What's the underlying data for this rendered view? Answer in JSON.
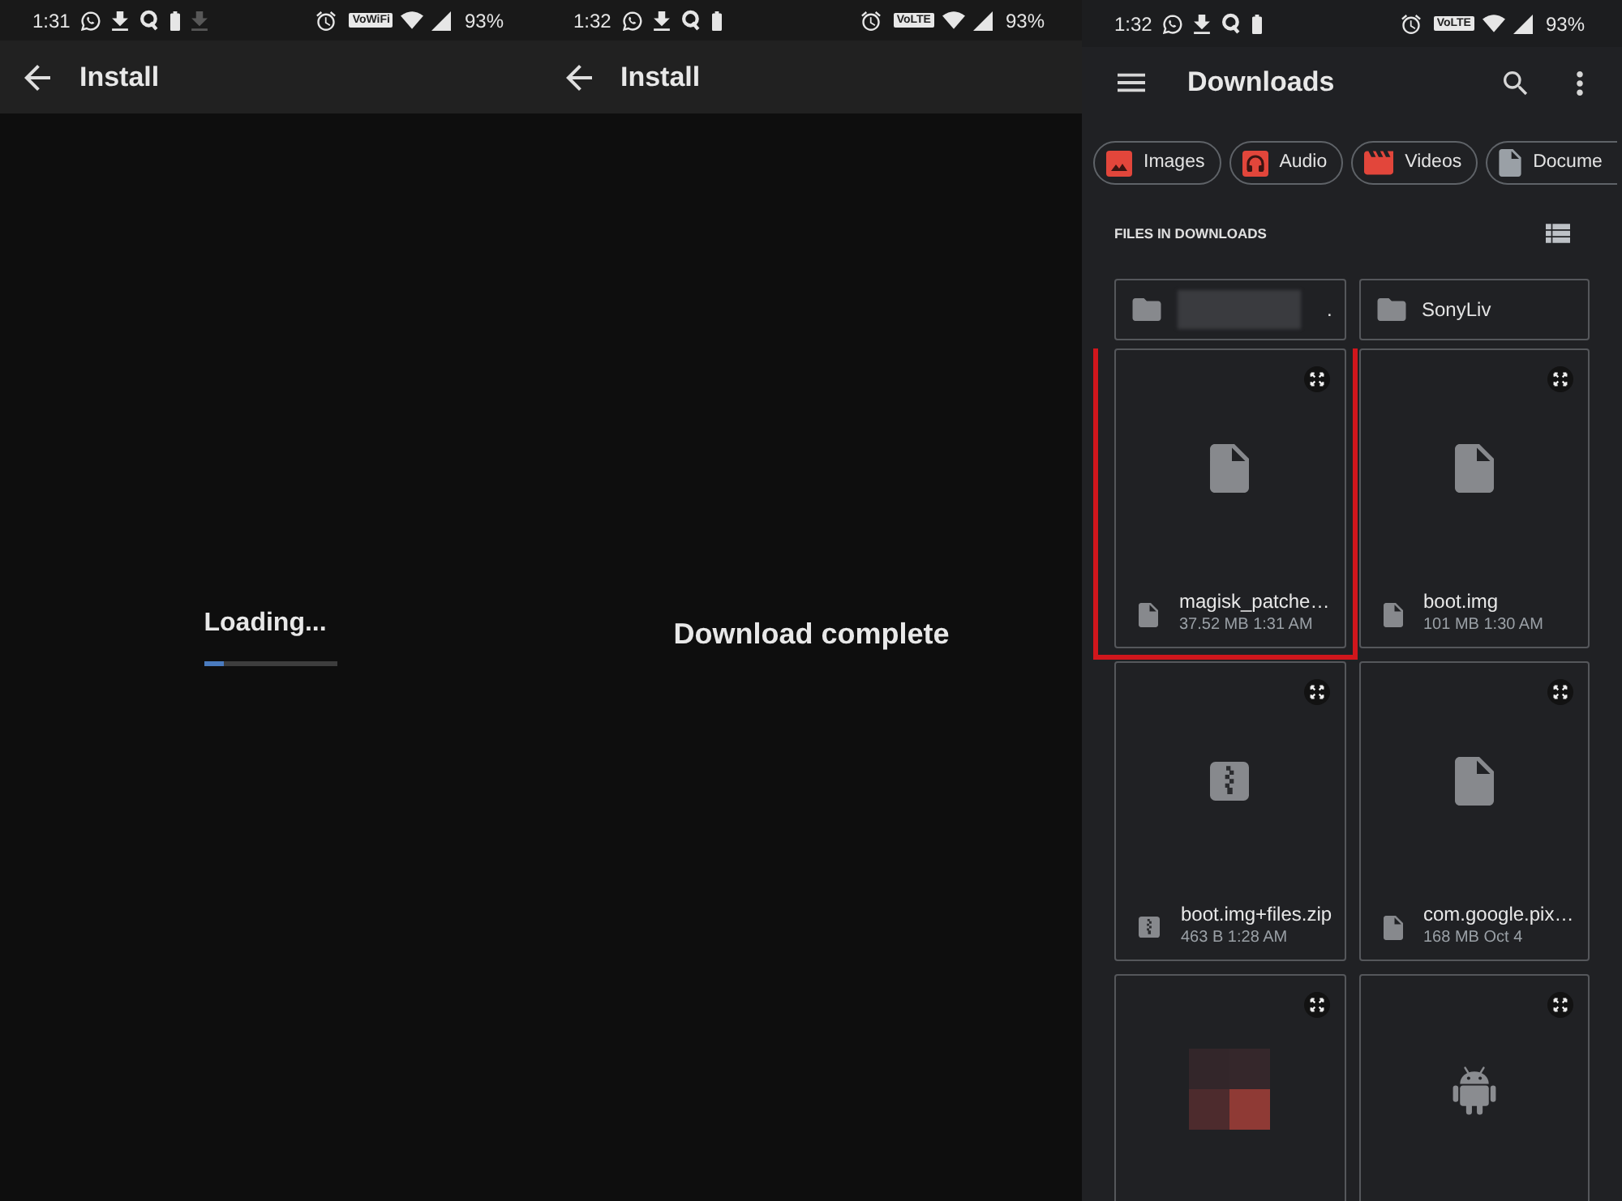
{
  "screens": [
    {
      "kind": "loading",
      "status_bar": {
        "time": "1:31",
        "notifications": [
          {
            "kind": "chat",
            "dimmed": false
          },
          {
            "kind": "download",
            "dimmed": false
          },
          {
            "kind": "q",
            "dimmed": false
          },
          {
            "kind": "battery",
            "dimmed": false
          },
          {
            "kind": "download",
            "dimmed": true
          }
        ],
        "network_badge": "VoWiFi",
        "battery": "93%"
      },
      "title": "Install",
      "message": "Loading...",
      "progress": {
        "level": 0.15
      }
    },
    {
      "kind": "message",
      "status_bar": {
        "time": "1:32",
        "notifications": [
          {
            "kind": "chat",
            "dimmed": false
          },
          {
            "kind": "download",
            "dimmed": false
          },
          {
            "kind": "q",
            "dimmed": false
          },
          {
            "kind": "battery",
            "dimmed": false
          }
        ],
        "network_badge": "VoLTE",
        "battery": "93%"
      },
      "title": "Install",
      "message": "Download complete"
    }
  ],
  "files_app": {
    "status_bar": {
      "time": "1:32",
      "notifications": [
        {
          "kind": "chat",
          "dimmed": false
        },
        {
          "kind": "download",
          "dimmed": false
        },
        {
          "kind": "q",
          "dimmed": false
        },
        {
          "kind": "battery",
          "dimmed": false
        }
      ],
      "network_badge": "VoLTE",
      "battery": "93%"
    },
    "title": "Downloads",
    "chips": [
      {
        "kind": "image",
        "label": "Images"
      },
      {
        "kind": "audio",
        "label": "Audio"
      },
      {
        "kind": "video",
        "label": "Videos"
      },
      {
        "kind": "document",
        "label": "Docume"
      }
    ],
    "section_title": "FILES IN DOWNLOADS",
    "folders": [
      {
        "name": ".",
        "redacted": true
      },
      {
        "name": "SonyLiv",
        "redacted": false
      }
    ],
    "files": [
      {
        "kind": "file",
        "name": "magisk_patche…",
        "meta": "37.52 MB 1:31 AM",
        "highlighted": true
      },
      {
        "kind": "file",
        "name": "boot.img",
        "meta": "101 MB 1:30 AM",
        "highlighted": false
      },
      {
        "kind": "zip",
        "name": "boot.img+files.zip",
        "meta": "463 B 1:28 AM",
        "highlighted": false
      },
      {
        "kind": "file",
        "name": "com.google.pix…",
        "meta": "168 MB Oct 4",
        "highlighted": false
      },
      {
        "kind": "image",
        "highlighted": false
      },
      {
        "kind": "apk",
        "highlighted": false
      }
    ]
  }
}
